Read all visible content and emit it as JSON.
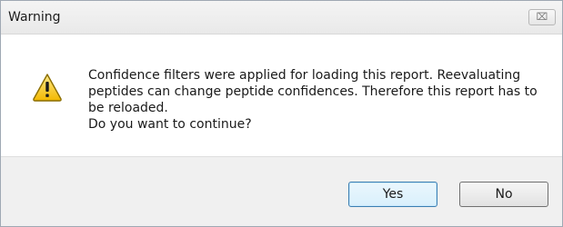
{
  "window": {
    "title": "Warning",
    "close_glyph": "⌧"
  },
  "dialog": {
    "icon": "warning-triangle-icon",
    "message_lines": [
      "Confidence filters were applied for loading this report. Reevaluating",
      "peptides can change peptide confidences. Therefore this report has to",
      "be reloaded.",
      "Do you want to continue?"
    ]
  },
  "buttons": {
    "yes_label": "Yes",
    "no_label": "No"
  },
  "colors": {
    "warning_fill": "#f5c400",
    "warning_border": "#8a6d00",
    "default_button_border": "#3c7fb1"
  }
}
